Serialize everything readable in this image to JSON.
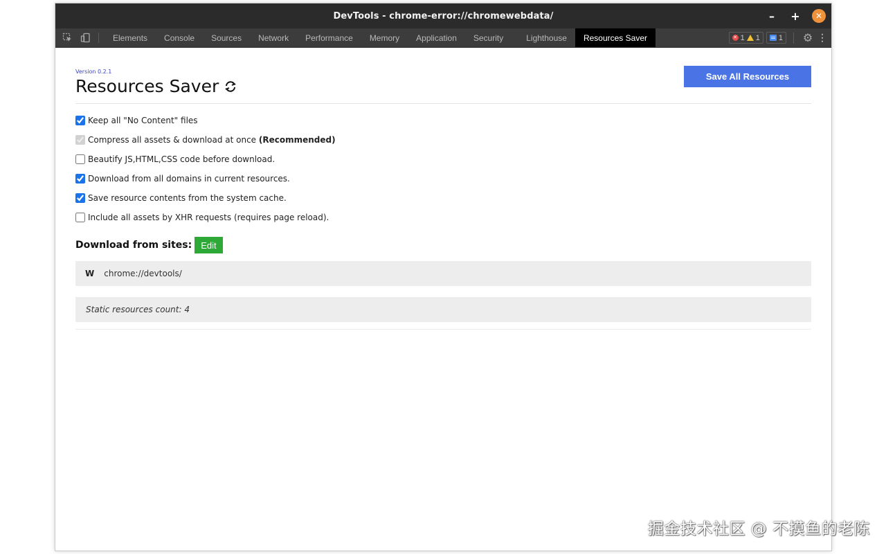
{
  "window": {
    "title": "DevTools - chrome-error://chromewebdata/",
    "controls": {
      "minimize": "–",
      "maximize": "+",
      "close": "✕"
    }
  },
  "toolbar": {
    "icons": [
      "inspect-element-icon",
      "device-toggle-icon"
    ],
    "tabs": [
      {
        "label": "Elements",
        "active": false
      },
      {
        "label": "Console",
        "active": false
      },
      {
        "label": "Sources",
        "active": false
      },
      {
        "label": "Network",
        "active": false
      },
      {
        "label": "Performance",
        "active": false
      },
      {
        "label": "Memory",
        "active": false
      },
      {
        "label": "Application",
        "active": false
      },
      {
        "label": "Security",
        "active": false
      },
      {
        "label": "Lighthouse",
        "active": false
      },
      {
        "label": "Resources Saver",
        "active": true
      }
    ],
    "errors": "1",
    "warnings": "1",
    "messages": "1",
    "settings_icon": "gear-icon",
    "more_icon": "kebab-menu-icon"
  },
  "panel": {
    "version": "Version 0.2.1",
    "title": "Resources Saver",
    "save_all_label": "Save All Resources",
    "options": [
      {
        "label": "Keep all \"No Content\" files",
        "bold": "",
        "checked": true,
        "disabled": false
      },
      {
        "label": "Compress all assets & download at once ",
        "bold": "(Recommended)",
        "checked": true,
        "disabled": true
      },
      {
        "label": "Beautify JS,HTML,CSS code before download.",
        "bold": "",
        "checked": false,
        "disabled": false
      },
      {
        "label": "Download from all domains in current resources.",
        "bold": "",
        "checked": true,
        "disabled": false
      },
      {
        "label": "Save resource contents from the system cache.",
        "bold": "",
        "checked": true,
        "disabled": false
      },
      {
        "label": "Include all assets by XHR requests (requires page reload).",
        "bold": "",
        "checked": false,
        "disabled": false
      }
    ],
    "sites_label": "Download from sites:",
    "edit_label": "Edit",
    "site_marker": "W",
    "site_url": "chrome://devtools/",
    "static_count": "Static resources count: 4"
  },
  "watermark": "掘金技术社区 @ 不摸鱼的老陈",
  "colors": {
    "accent_blue": "#4a74e6",
    "edit_green": "#2ea836",
    "version_purple": "#3b43c6",
    "close_orange": "#f0923a"
  }
}
